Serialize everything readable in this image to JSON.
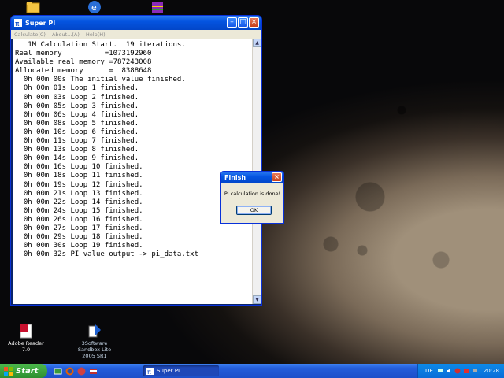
{
  "colors": {
    "titlebar": "#0454e0",
    "taskbar": "#245edb",
    "start": "#2f8f2f",
    "dialog_bg": "#ece9d8"
  },
  "desktop": {
    "icons": [
      {
        "name": "adobe-reader",
        "label": "Adobe Reader 7.0"
      },
      {
        "name": "software-update",
        "label": "3Software Sandbox Lite 2005 SR1"
      }
    ]
  },
  "window": {
    "title": "Super PI",
    "menu": [
      "Calculate(C)",
      "About...(A)",
      "Help(H)"
    ],
    "output_lines": [
      "   1M Calculation Start.  19 iterations.",
      "Real memory          =1073192960",
      "Available real memory =787243008",
      "Allocated memory      =  8388648",
      "  0h 00m 00s The initial value finished.",
      "  0h 00m 01s Loop 1 finished.",
      "  0h 00m 03s Loop 2 finished.",
      "  0h 00m 05s Loop 3 finished.",
      "  0h 00m 06s Loop 4 finished.",
      "  0h 00m 08s Loop 5 finished.",
      "  0h 00m 10s Loop 6 finished.",
      "  0h 00m 11s Loop 7 finished.",
      "  0h 00m 13s Loop 8 finished.",
      "  0h 00m 14s Loop 9 finished.",
      "  0h 00m 16s Loop 10 finished.",
      "  0h 00m 18s Loop 11 finished.",
      "  0h 00m 19s Loop 12 finished.",
      "  0h 00m 21s Loop 13 finished.",
      "  0h 00m 22s Loop 14 finished.",
      "  0h 00m 24s Loop 15 finished.",
      "  0h 00m 26s Loop 16 finished.",
      "  0h 00m 27s Loop 17 finished.",
      "  0h 00m 29s Loop 18 finished.",
      "  0h 00m 30s Loop 19 finished.",
      "  0h 00m 32s PI value output -> pi_data.txt"
    ]
  },
  "dialog": {
    "title": "Finish",
    "message": "PI calculation is done!",
    "ok_label": "OK"
  },
  "taskbar": {
    "start_label": "Start",
    "task_label": "Super PI",
    "tray": {
      "lang": "DE",
      "clock": "20:28"
    }
  }
}
